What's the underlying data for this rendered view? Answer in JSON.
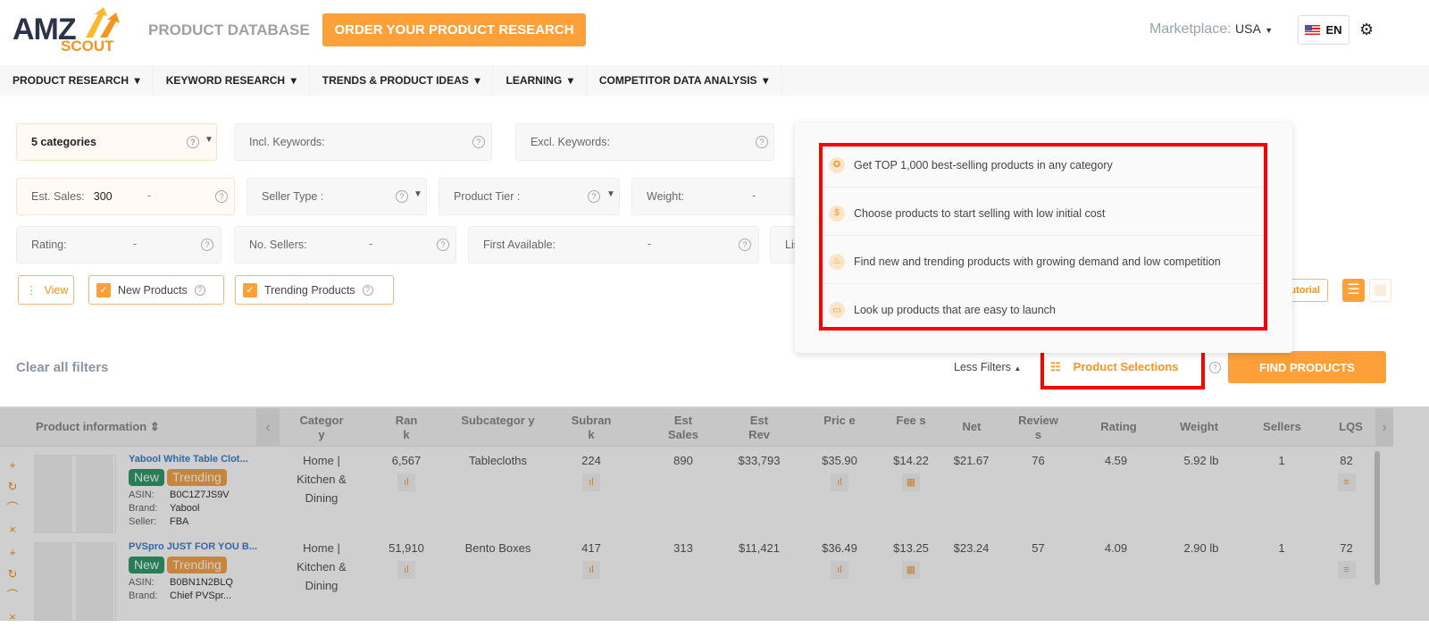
{
  "header": {
    "logo_top": "AMZ",
    "logo_bottom": "SCOUT",
    "title": "PRODUCT DATABASE",
    "order_button": "ORDER YOUR PRODUCT RESEARCH",
    "marketplace_label": "Marketplace:",
    "marketplace_value": "USA",
    "language": "EN"
  },
  "nav": [
    "PRODUCT RESEARCH",
    "KEYWORD RESEARCH",
    "TRENDS & PRODUCT IDEAS",
    "LEARNING",
    "COMPETITOR DATA ANALYSIS"
  ],
  "filters": {
    "categories": "5  categories",
    "incl_keywords": "Incl. Keywords:",
    "excl_keywords": "Excl. Keywords:",
    "est_sales": "Est. Sales:",
    "est_sales_min": "300",
    "seller_type": "Seller Type :",
    "product_tier": "Product Tier :",
    "weight": "Weight:",
    "rating": "Rating:",
    "no_sellers": "No. Sellers:",
    "first_available": "First Available:",
    "listing_partial": "Lis",
    "dash": "-",
    "view": "View",
    "new_products": "New Products",
    "trending_products": "Trending Products",
    "tutorial_partial": "utorial",
    "clear_all": "Clear all filters",
    "less_filters": "Less Filters",
    "product_selections": "Product Selections",
    "find_products": "FIND PRODUCTS"
  },
  "popup": {
    "items": [
      "Get TOP 1,000 best-selling products in any category",
      "Choose products to start selling with low initial cost",
      "Find new and trending products with growing demand and low competition",
      "Look up products that are easy to launch"
    ]
  },
  "table": {
    "headers": {
      "info": "Product information",
      "category": "Categor y",
      "rank": "Ran k",
      "subcategory": "Subcategor y",
      "subrank": "Subran k",
      "est_sales": "Est Sales",
      "est_rev": "Est Rev",
      "price": "Pric e",
      "fees": "Fee s",
      "net": "Net",
      "reviews": "Review s",
      "rating": "Rating",
      "weight": "Weight",
      "sellers": "Sellers",
      "lqs": "LQS"
    },
    "labels": {
      "asin": "ASIN:",
      "brand": "Brand:",
      "seller": "Seller:",
      "new": "New",
      "trending": "Trending"
    },
    "rows": [
      {
        "title": "Yabool White Table Clot...",
        "asin": "B0C1Z7JS9V",
        "brand": "Yabool",
        "seller": "FBA",
        "category": "Home | Kitchen & Dining",
        "rank": "6,567",
        "subcategory": "Tablecloths",
        "subrank": "224",
        "est_sales": "890",
        "est_rev": "$33,793",
        "price": "$35.90",
        "fees": "$14.22",
        "net": "$21.67",
        "reviews": "76",
        "rating": "4.59",
        "weight": "5.92 lb",
        "sellers": "1",
        "lqs": "82"
      },
      {
        "title": "PVSpro JUST FOR YOU B...",
        "asin": "B0BN1N2BLQ",
        "brand": "Chief PVSpr...",
        "seller": "",
        "category": "Home | Kitchen & Dining",
        "rank": "51,910",
        "subcategory": "Bento Boxes",
        "subrank": "417",
        "est_sales": "313",
        "est_rev": "$11,421",
        "price": "$36.49",
        "fees": "$13.25",
        "net": "$23.24",
        "reviews": "57",
        "rating": "4.09",
        "weight": "2.90 lb",
        "sellers": "1",
        "lqs": "72"
      }
    ]
  }
}
